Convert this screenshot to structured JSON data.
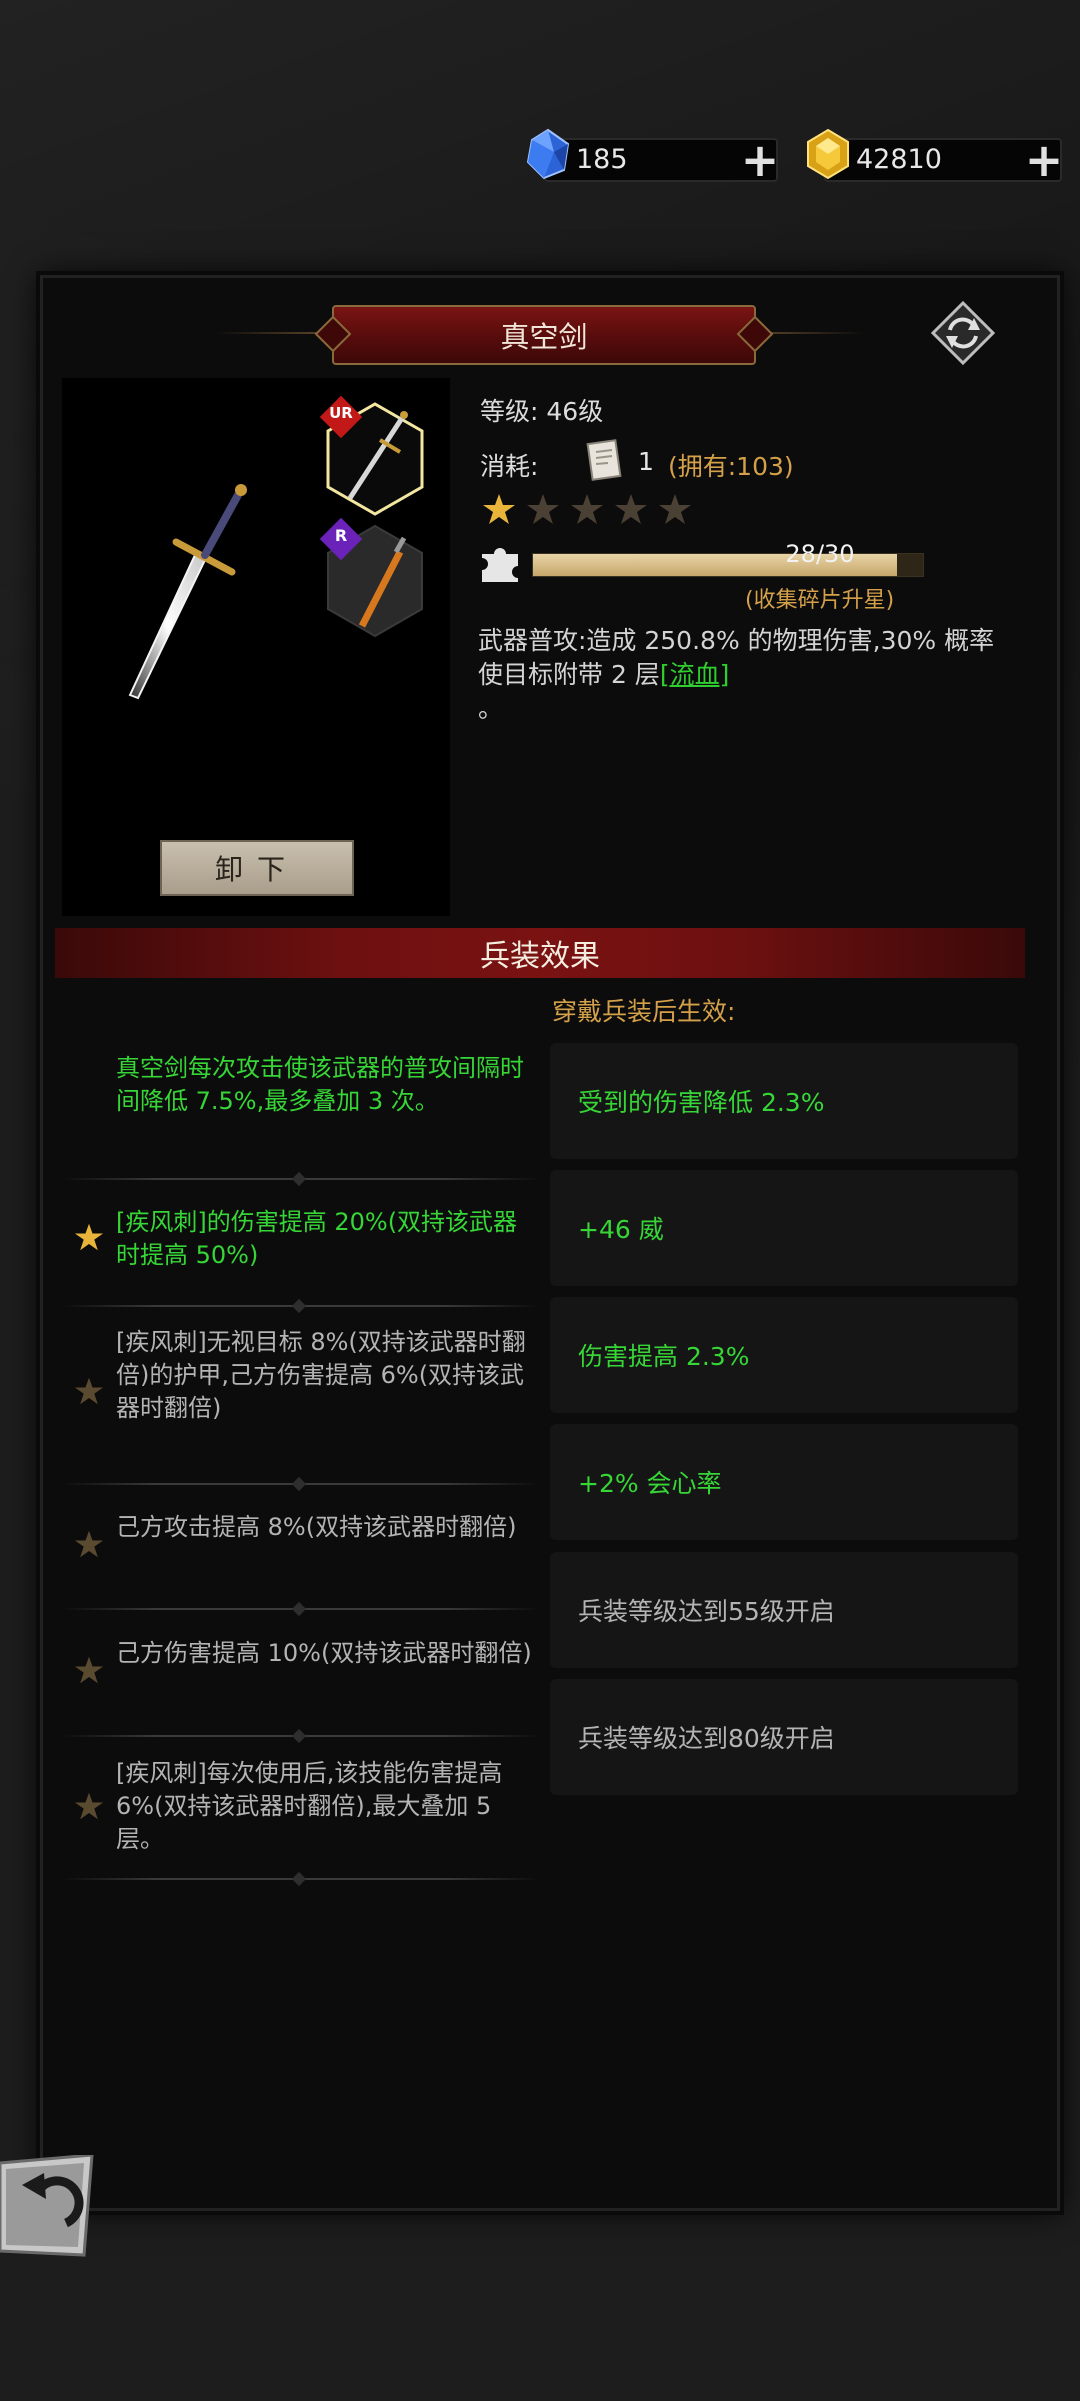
{
  "currency": {
    "gems": "185",
    "gold": "42810"
  },
  "weapon": {
    "name": "真空剑",
    "level_label": "等级:",
    "level_value": "46级",
    "cost_label": "消耗:",
    "cost_amount": "1",
    "cost_owned": "(拥有:103)",
    "stars_filled": 1,
    "stars_total": 5,
    "fragments_text": "28/30",
    "fragments_progress": 0.9333,
    "collect_hint": "(收集碎片升星)",
    "desc_text": "武器普攻:造成 250.8% 的物理伤害,30% 概率使目标附带 2 层",
    "desc_link": "[流血]",
    "desc_tail": "。",
    "unload_label": "卸下",
    "slot_badges": [
      "UR",
      "R"
    ]
  },
  "effects": {
    "section_title": "兵装效果",
    "equip_header": "穿戴兵装后生效:",
    "left": [
      {
        "text": "真空剑每次攻击使该武器的普攻间隔时间降低 7.5%,最多叠加 3 次。",
        "active": true,
        "star": false
      },
      {
        "text": "[疾风刺]的伤害提高 20%(双持该武器时提高 50%)",
        "active": true,
        "star": true
      },
      {
        "text": "[疾风刺]无视目标 8%(双持该武器时翻倍)的护甲,己方伤害提高 6%(双持该武器时翻倍)",
        "active": false,
        "star": true
      },
      {
        "text": "己方攻击提高 8%(双持该武器时翻倍)",
        "active": false,
        "star": true
      },
      {
        "text": "己方伤害提高 10%(双持该武器时翻倍)",
        "active": false,
        "star": true
      },
      {
        "text": "[疾风刺]每次使用后,该技能伤害提高 6%(双持该武器时翻倍),最大叠加 5 层。",
        "active": false,
        "star": true
      }
    ],
    "right": [
      {
        "text": "受到的伤害降低 2.3%",
        "active": true
      },
      {
        "text": "+46 威",
        "active": true
      },
      {
        "text": "伤害提高 2.3%",
        "active": true
      },
      {
        "text": "+2% 会心率",
        "active": true
      },
      {
        "text": "兵装等级达到55级开启",
        "active": false
      },
      {
        "text": "兵装等级达到80级开启",
        "active": false
      }
    ]
  },
  "colors": {
    "active_green": "#37d637",
    "gold_accent": "#d4a04a",
    "banner_red": "#7a1414"
  }
}
